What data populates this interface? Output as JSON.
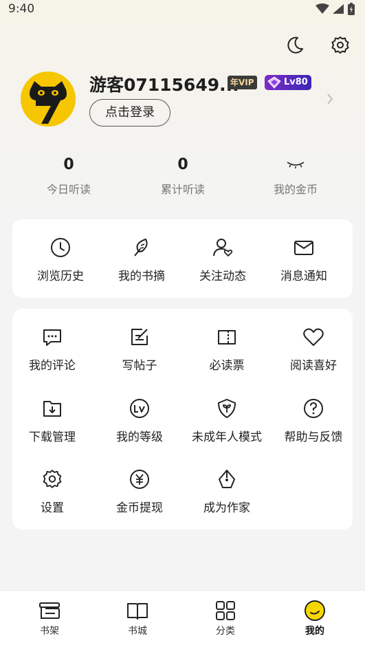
{
  "status_bar": {
    "time": "9:40"
  },
  "profile": {
    "username": "游客07115649...",
    "badge_year": "年VIP",
    "badge_level": "Lv80",
    "login_label": "点击登录"
  },
  "stats": [
    {
      "value": "0",
      "label": "今日听读"
    },
    {
      "value": "0",
      "label": "累计听读"
    },
    {
      "value": "",
      "label": "我的金币"
    }
  ],
  "quick_menu": [
    {
      "label": "浏览历史",
      "icon": "clock-icon"
    },
    {
      "label": "我的书摘",
      "icon": "feather-icon"
    },
    {
      "label": "关注动态",
      "icon": "user-heart-icon"
    },
    {
      "label": "消息通知",
      "icon": "mail-icon"
    }
  ],
  "more_menu": [
    {
      "label": "我的评论",
      "icon": "comment-icon"
    },
    {
      "label": "写帖子",
      "icon": "edit-icon"
    },
    {
      "label": "必读票",
      "icon": "ticket-icon"
    },
    {
      "label": "阅读喜好",
      "icon": "heart-icon"
    },
    {
      "label": "下载管理",
      "icon": "download-folder-icon"
    },
    {
      "label": "我的等级",
      "icon": "level-icon"
    },
    {
      "label": "未成年人模式",
      "icon": "shield-sprout-icon"
    },
    {
      "label": "帮助与反馈",
      "icon": "help-icon"
    },
    {
      "label": "设置",
      "icon": "gear-icon"
    },
    {
      "label": "金币提现",
      "icon": "yen-coin-icon"
    },
    {
      "label": "成为作家",
      "icon": "pen-nib-icon"
    }
  ],
  "tabbar": [
    {
      "label": "书架",
      "icon": "bookshelf-icon"
    },
    {
      "label": "书城",
      "icon": "book-open-icon"
    },
    {
      "label": "分类",
      "icon": "grid-icon"
    },
    {
      "label": "我的",
      "icon": "smile-face-icon",
      "active": true
    }
  ],
  "colors": {
    "accent": "#f6c600",
    "level_badge": "#5b2ac0"
  }
}
